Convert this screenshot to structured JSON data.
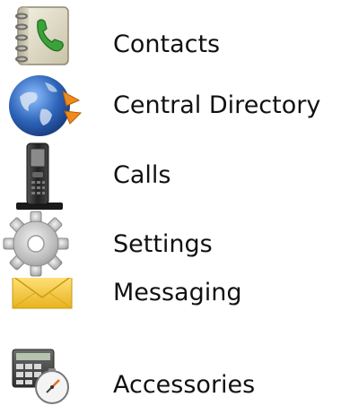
{
  "menu": {
    "items": [
      {
        "label": "Contacts",
        "icon": "address-book-icon"
      },
      {
        "label": "Central Directory",
        "icon": "globe-icon"
      },
      {
        "label": "Calls",
        "icon": "phone-icon"
      },
      {
        "label": "Settings",
        "icon": "gear-icon"
      },
      {
        "label": "Messaging",
        "icon": "envelope-icon"
      },
      {
        "label": "Accessories",
        "icon": "calculator-clock-icon"
      }
    ]
  },
  "colors": {
    "text": "#111111",
    "phone_green": "#3aa23a",
    "globe_blue": "#2d63b8",
    "envelope_yellow": "#f2c531",
    "gear_gray": "#b9b9b9"
  }
}
